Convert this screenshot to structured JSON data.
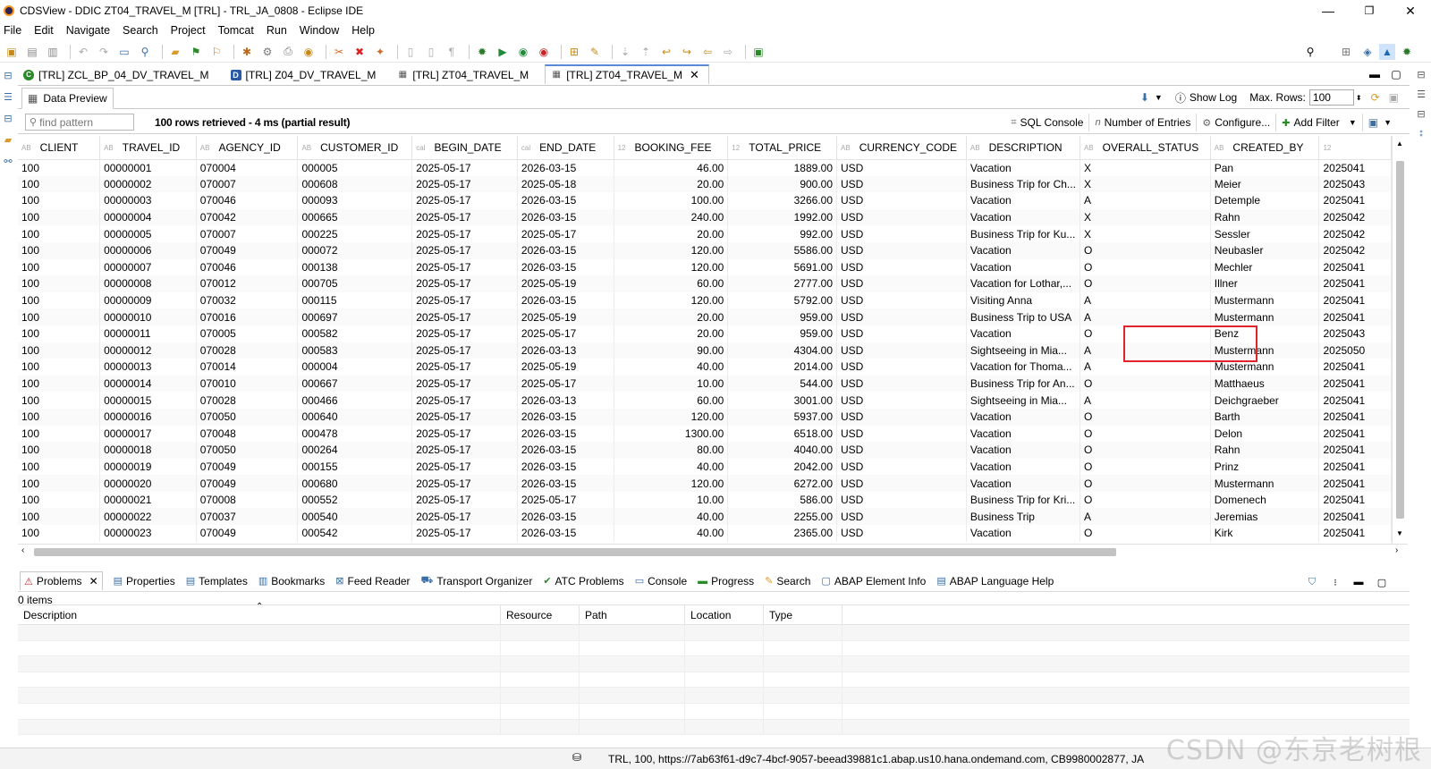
{
  "window": {
    "title": "CDSView - DDIC ZT04_TRAVEL_M [TRL] - TRL_JA_0808 - Eclipse IDE",
    "minimize": "—",
    "maximize": "❐",
    "close": "✕"
  },
  "menu": [
    "File",
    "Edit",
    "Navigate",
    "Search",
    "Project",
    "Tomcat",
    "Run",
    "Window",
    "Help"
  ],
  "editor_tabs": [
    {
      "label": "[TRL] ZCL_BP_04_DV_TRAVEL_M",
      "icon": "class-icon",
      "active": false
    },
    {
      "label": "[TRL] Z04_DV_TRAVEL_M",
      "icon": "ddl-icon",
      "active": false
    },
    {
      "label": "[TRL] ZT04_TRAVEL_M",
      "icon": "table-icon",
      "active": false
    },
    {
      "label": "[TRL] ZT04_TRAVEL_M",
      "icon": "table-icon",
      "active": true
    }
  ],
  "data_preview": {
    "tab_label": "Data Preview",
    "show_log": "Show Log",
    "max_rows_label": "Max. Rows:",
    "max_rows_value": "100",
    "find_placeholder": "find pattern",
    "rows_status": "100 rows retrieved - 4 ms (partial result)",
    "sql_console": "SQL Console",
    "number_of_entries": "Number of Entries",
    "configure": "Configure...",
    "add_filter": "Add Filter"
  },
  "table": {
    "columns": [
      "CLIENT",
      "TRAVEL_ID",
      "AGENCY_ID",
      "CUSTOMER_ID",
      "BEGIN_DATE",
      "END_DATE",
      "BOOKING_FEE",
      "TOTAL_PRICE",
      "CURRENCY_CODE",
      "DESCRIPTION",
      "OVERALL_STATUS",
      "CREATED_BY",
      ""
    ],
    "column_type_icons": [
      "AB",
      "AB",
      "AB",
      "AB",
      "cal",
      "cal",
      "12",
      "12",
      "AB",
      "AB",
      "AB",
      "AB",
      "12"
    ],
    "rows": [
      [
        "100",
        "00000001",
        "070004",
        "000005",
        "2025-05-17",
        "2026-03-15",
        "46.00",
        "1889.00",
        "USD",
        "Vacation",
        "X",
        "Pan",
        "2025041"
      ],
      [
        "100",
        "00000002",
        "070007",
        "000608",
        "2025-05-17",
        "2025-05-18",
        "20.00",
        "900.00",
        "USD",
        "Business Trip for Ch...",
        "X",
        "Meier",
        "2025043"
      ],
      [
        "100",
        "00000003",
        "070046",
        "000093",
        "2025-05-17",
        "2026-03-15",
        "100.00",
        "3266.00",
        "USD",
        "Vacation",
        "A",
        "Detemple",
        "2025041"
      ],
      [
        "100",
        "00000004",
        "070042",
        "000665",
        "2025-05-17",
        "2026-03-15",
        "240.00",
        "1992.00",
        "USD",
        "Vacation",
        "X",
        "Rahn",
        "2025042"
      ],
      [
        "100",
        "00000005",
        "070007",
        "000225",
        "2025-05-17",
        "2025-05-17",
        "20.00",
        "992.00",
        "USD",
        "Business Trip for Ku...",
        "X",
        "Sessler",
        "2025042"
      ],
      [
        "100",
        "00000006",
        "070049",
        "000072",
        "2025-05-17",
        "2026-03-15",
        "120.00",
        "5586.00",
        "USD",
        "Vacation",
        "O",
        "Neubasler",
        "2025042"
      ],
      [
        "100",
        "00000007",
        "070046",
        "000138",
        "2025-05-17",
        "2026-03-15",
        "120.00",
        "5691.00",
        "USD",
        "Vacation",
        "O",
        "Mechler",
        "2025041"
      ],
      [
        "100",
        "00000008",
        "070012",
        "000705",
        "2025-05-17",
        "2025-05-19",
        "60.00",
        "2777.00",
        "USD",
        "Vacation for Lothar,...",
        "O",
        "Illner",
        "2025041"
      ],
      [
        "100",
        "00000009",
        "070032",
        "000115",
        "2025-05-17",
        "2026-03-15",
        "120.00",
        "5792.00",
        "USD",
        "Visiting Anna",
        "A",
        "Mustermann",
        "2025041"
      ],
      [
        "100",
        "00000010",
        "070016",
        "000697",
        "2025-05-17",
        "2025-05-19",
        "20.00",
        "959.00",
        "USD",
        "Business Trip to USA",
        "A",
        "Mustermann",
        "2025041"
      ],
      [
        "100",
        "00000011",
        "070005",
        "000582",
        "2025-05-17",
        "2025-05-17",
        "20.00",
        "959.00",
        "USD",
        "Vacation",
        "O",
        "Benz",
        "2025043"
      ],
      [
        "100",
        "00000012",
        "070028",
        "000583",
        "2025-05-17",
        "2026-03-13",
        "90.00",
        "4304.00",
        "USD",
        "Sightseeing in Mia...",
        "A",
        "Mustermann",
        "2025050"
      ],
      [
        "100",
        "00000013",
        "070014",
        "000004",
        "2025-05-17",
        "2025-05-19",
        "40.00",
        "2014.00",
        "USD",
        "Vacation for Thoma...",
        "A",
        "Mustermann",
        "2025041"
      ],
      [
        "100",
        "00000014",
        "070010",
        "000667",
        "2025-05-17",
        "2025-05-17",
        "10.00",
        "544.00",
        "USD",
        "Business Trip for An...",
        "O",
        "Matthaeus",
        "2025041"
      ],
      [
        "100",
        "00000015",
        "070028",
        "000466",
        "2025-05-17",
        "2026-03-13",
        "60.00",
        "3001.00",
        "USD",
        "Sightseeing in Mia...",
        "A",
        "Deichgraeber",
        "2025041"
      ],
      [
        "100",
        "00000016",
        "070050",
        "000640",
        "2025-05-17",
        "2026-03-15",
        "120.00",
        "5937.00",
        "USD",
        "Vacation",
        "O",
        "Barth",
        "2025041"
      ],
      [
        "100",
        "00000017",
        "070048",
        "000478",
        "2025-05-17",
        "2026-03-15",
        "1300.00",
        "6518.00",
        "USD",
        "Vacation",
        "O",
        "Delon",
        "2025041"
      ],
      [
        "100",
        "00000018",
        "070050",
        "000264",
        "2025-05-17",
        "2026-03-15",
        "80.00",
        "4040.00",
        "USD",
        "Vacation",
        "O",
        "Rahn",
        "2025041"
      ],
      [
        "100",
        "00000019",
        "070049",
        "000155",
        "2025-05-17",
        "2026-03-15",
        "40.00",
        "2042.00",
        "USD",
        "Vacation",
        "O",
        "Prinz",
        "2025041"
      ],
      [
        "100",
        "00000020",
        "070049",
        "000680",
        "2025-05-17",
        "2026-03-15",
        "120.00",
        "6272.00",
        "USD",
        "Vacation",
        "O",
        "Mustermann",
        "2025041"
      ],
      [
        "100",
        "00000021",
        "070008",
        "000552",
        "2025-05-17",
        "2025-05-17",
        "10.00",
        "586.00",
        "USD",
        "Business Trip for Kri...",
        "O",
        "Domenech",
        "2025041"
      ],
      [
        "100",
        "00000022",
        "070037",
        "000540",
        "2025-05-17",
        "2026-03-15",
        "40.00",
        "2255.00",
        "USD",
        "Business Trip",
        "A",
        "Jeremias",
        "2025041"
      ],
      [
        "100",
        "00000023",
        "070049",
        "000542",
        "2025-05-17",
        "2026-03-15",
        "40.00",
        "2365.00",
        "USD",
        "Vacation",
        "O",
        "Kirk",
        "2025041"
      ]
    ]
  },
  "views": {
    "tabs": [
      "Problems",
      "Properties",
      "Templates",
      "Bookmarks",
      "Feed Reader",
      "Transport Organizer",
      "ATC Problems",
      "Console",
      "Progress",
      "Search",
      "ABAP Element Info",
      "ABAP Language Help"
    ],
    "items_count": "0 items",
    "problems_columns": [
      "Description",
      "Resource",
      "Path",
      "Location",
      "Type"
    ]
  },
  "status": {
    "text": "TRL, 100, https://7ab63f61-d9c7-4bcf-9057-beead39881c1.abap.us10.hana.ondemand.com, CB9980002877, JA"
  },
  "watermark": "CSDN @东京老树根",
  "colors": {
    "highlight": "#e0242a",
    "active_tab_border": "#5a8ad6"
  }
}
